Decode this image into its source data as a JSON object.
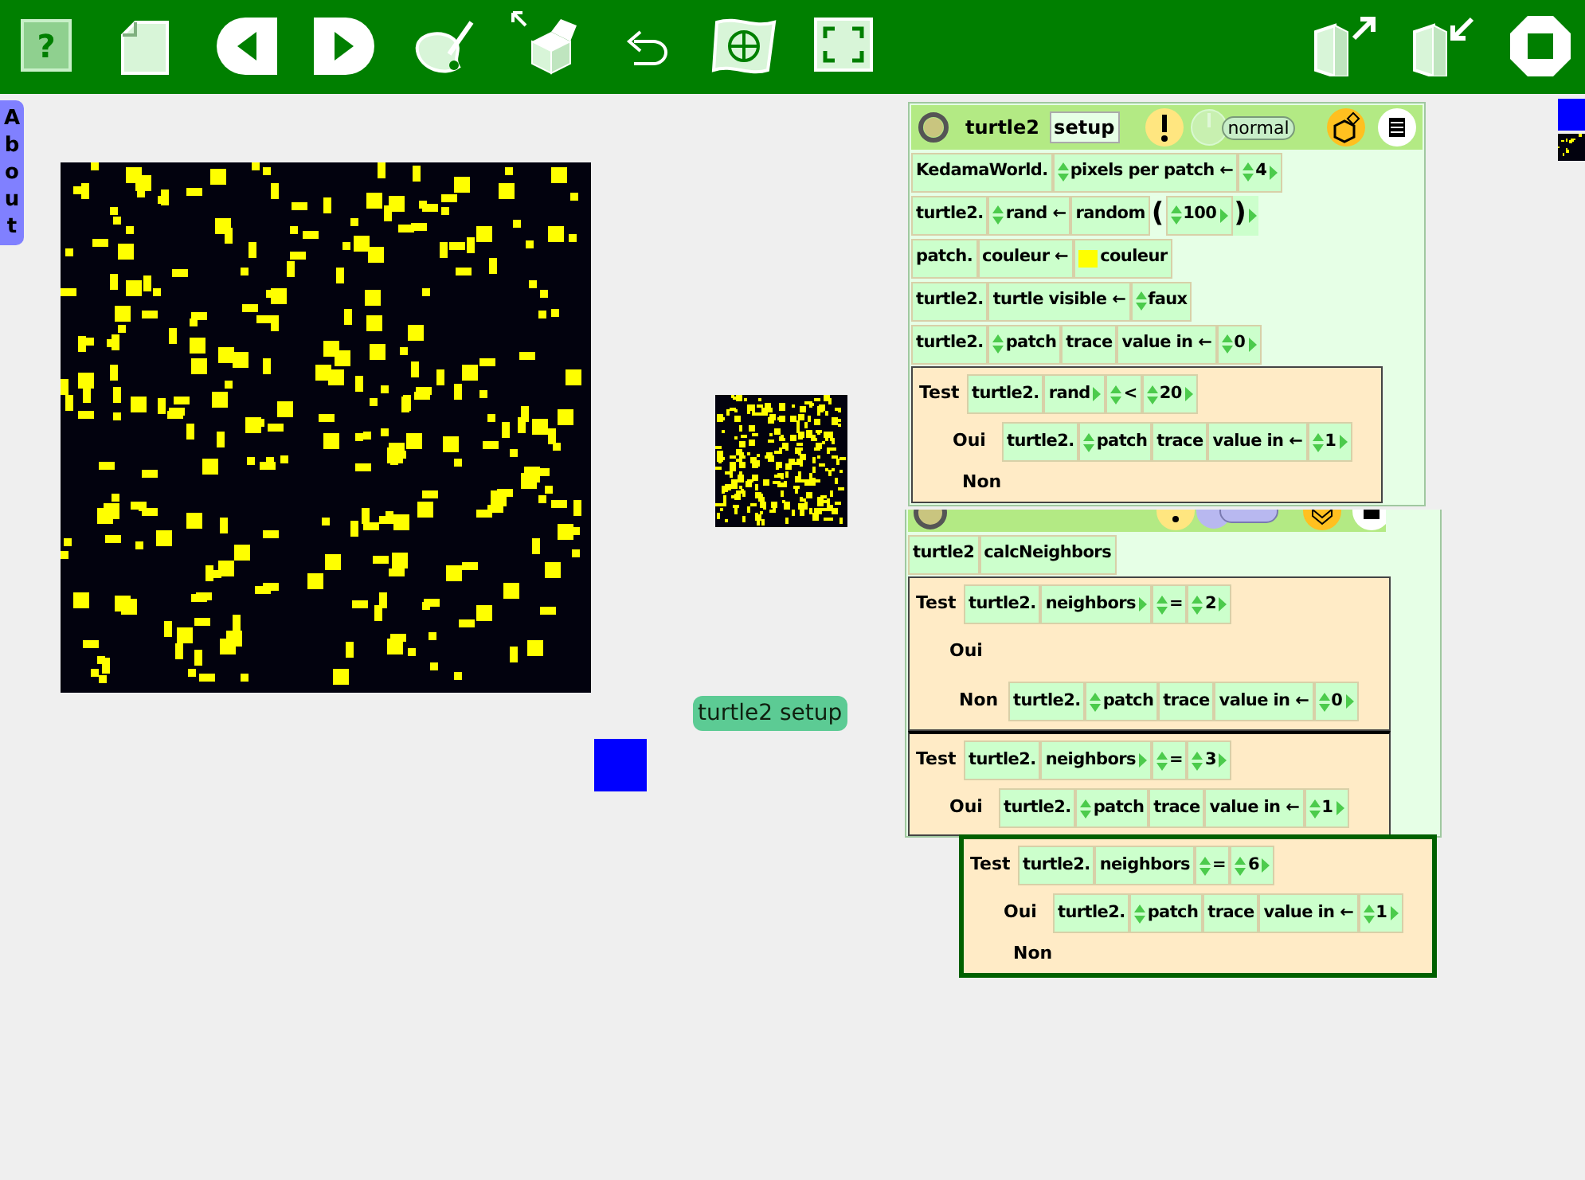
{
  "toolbar": {
    "help_label": "?"
  },
  "about_tab": {
    "label": "About"
  },
  "world": {
    "button": {
      "label": "turtle2 setup"
    }
  },
  "scripts": [
    {
      "kind": "editor",
      "player": "turtle2",
      "name": "setup",
      "tick_status": "normal",
      "lines": [
        {
          "kind": "row",
          "tiles": [
            {
              "kind": "tile",
              "text": "KedamaWorld.",
              "arrows": false,
              "more": false
            },
            {
              "kind": "tile",
              "text": "pixels per patch ←",
              "arrows": true,
              "more": false
            },
            {
              "kind": "tile",
              "text": "4",
              "arrows": true,
              "more": true
            }
          ]
        },
        {
          "kind": "row",
          "tiles": [
            {
              "kind": "tile",
              "text": "turtle2.",
              "arrows": false,
              "more": false
            },
            {
              "kind": "tile",
              "text": "rand ←",
              "arrows": true,
              "more": false
            },
            {
              "kind": "tile",
              "text": "random",
              "arrows": false,
              "more": false
            },
            {
              "kind": "paren",
              "text": "(",
              "more": false
            },
            {
              "kind": "tile",
              "text": "100",
              "arrows": true,
              "more": true
            },
            {
              "kind": "paren",
              "text": ")",
              "more": true
            }
          ]
        },
        {
          "kind": "row",
          "tiles": [
            {
              "kind": "tile",
              "text": "patch.",
              "arrows": false,
              "more": false
            },
            {
              "kind": "tile",
              "text": "couleur ←",
              "arrows": false,
              "more": false
            },
            {
              "kind": "tile",
              "text": "couleur",
              "arrows": false,
              "more": false,
              "color": "#ffff00"
            }
          ]
        },
        {
          "kind": "row",
          "tiles": [
            {
              "kind": "tile",
              "text": "turtle2.",
              "arrows": false,
              "more": false
            },
            {
              "kind": "tile",
              "text": "turtle visible ←",
              "arrows": false,
              "more": false
            },
            {
              "kind": "tile",
              "text": "faux",
              "arrows": true,
              "more": false
            }
          ]
        },
        {
          "kind": "row",
          "tiles": [
            {
              "kind": "tile",
              "text": "turtle2.",
              "arrows": false,
              "more": false
            },
            {
              "kind": "tile",
              "text": "patch",
              "arrows": true,
              "more": false
            },
            {
              "kind": "tile",
              "text": "trace",
              "arrows": false,
              "more": false
            },
            {
              "kind": "tile",
              "text": "value in ←",
              "arrows": false,
              "more": false
            },
            {
              "kind": "tile",
              "text": "0",
              "arrows": true,
              "more": true
            }
          ]
        },
        {
          "kind": "test",
          "highlighted": false,
          "label": "Test",
          "condition": [
            {
              "kind": "tile",
              "text": "turtle2.",
              "arrows": false,
              "more": false
            },
            {
              "kind": "tile",
              "text": "rand",
              "arrows": false,
              "more": true
            },
            {
              "kind": "tile",
              "text": "<",
              "arrows": true,
              "more": false
            },
            {
              "kind": "tile",
              "text": "20",
              "arrows": true,
              "more": true
            }
          ],
          "yes_label": "Oui",
          "yes": [
            {
              "kind": "tile",
              "text": "turtle2.",
              "arrows": false,
              "more": false
            },
            {
              "kind": "tile",
              "text": "patch",
              "arrows": true,
              "more": false
            },
            {
              "kind": "tile",
              "text": "trace",
              "arrows": false,
              "more": false
            },
            {
              "kind": "tile",
              "text": "value in ←",
              "arrows": false,
              "more": false
            },
            {
              "kind": "tile",
              "text": "1",
              "arrows": true,
              "more": true
            }
          ],
          "no_label": "Non"
        }
      ]
    },
    {
      "kind": "covered_editor",
      "lines": [
        {
          "kind": "row",
          "tiles": [
            {
              "kind": "tile",
              "text": "turtle2",
              "arrows": false,
              "more": false
            },
            {
              "kind": "tile",
              "text": "calcNeighbors",
              "arrows": false,
              "more": false
            }
          ]
        },
        {
          "kind": "test",
          "highlighted": false,
          "label": "Test",
          "condition": [
            {
              "kind": "tile",
              "text": "turtle2.",
              "arrows": false,
              "more": false
            },
            {
              "kind": "tile",
              "text": "neighbors",
              "arrows": false,
              "more": true
            },
            {
              "kind": "tile",
              "text": "=",
              "arrows": true,
              "more": false
            },
            {
              "kind": "tile",
              "text": "2",
              "arrows": true,
              "more": true
            }
          ],
          "yes_label": "Oui",
          "no_label": "Non",
          "no": [
            {
              "kind": "tile",
              "text": "turtle2.",
              "arrows": false,
              "more": false
            },
            {
              "kind": "tile",
              "text": "patch",
              "arrows": true,
              "more": false
            },
            {
              "kind": "tile",
              "text": "trace",
              "arrows": false,
              "more": false
            },
            {
              "kind": "tile",
              "text": "value in ←",
              "arrows": false,
              "more": false
            },
            {
              "kind": "tile",
              "text": "0",
              "arrows": true,
              "more": true
            }
          ]
        },
        {
          "kind": "test",
          "highlighted": false,
          "label": "Test",
          "condition": [
            {
              "kind": "tile",
              "text": "turtle2.",
              "arrows": false,
              "more": false
            },
            {
              "kind": "tile",
              "text": "neighbors",
              "arrows": false,
              "more": true
            },
            {
              "kind": "tile",
              "text": "=",
              "arrows": true,
              "more": false
            },
            {
              "kind": "tile",
              "text": "3",
              "arrows": true,
              "more": true
            }
          ],
          "yes_label": "Oui",
          "yes": [
            {
              "kind": "tile",
              "text": "turtle2.",
              "arrows": false,
              "more": false
            },
            {
              "kind": "tile",
              "text": "patch",
              "arrows": true,
              "more": false
            },
            {
              "kind": "tile",
              "text": "trace",
              "arrows": false,
              "more": false
            },
            {
              "kind": "tile",
              "text": "value in ←",
              "arrows": false,
              "more": false
            },
            {
              "kind": "tile",
              "text": "1",
              "arrows": true,
              "more": true
            }
          ]
        }
      ]
    },
    {
      "kind": "loose_block",
      "lines": [
        {
          "kind": "test",
          "highlighted": true,
          "label": "Test",
          "condition": [
            {
              "kind": "tile",
              "text": "turtle2.",
              "arrows": false,
              "more": false
            },
            {
              "kind": "tile",
              "text": "neighbors",
              "arrows": false,
              "more": false
            },
            {
              "kind": "tile",
              "text": "=",
              "arrows": true,
              "more": false
            },
            {
              "kind": "tile",
              "text": "6",
              "arrows": true,
              "more": true
            }
          ],
          "yes_label": "Oui",
          "yes": [
            {
              "kind": "tile",
              "text": "turtle2.",
              "arrows": false,
              "more": false
            },
            {
              "kind": "tile",
              "text": "patch",
              "arrows": true,
              "more": false
            },
            {
              "kind": "tile",
              "text": "trace",
              "arrows": false,
              "more": false
            },
            {
              "kind": "tile",
              "text": "value in ←",
              "arrows": false,
              "more": false
            },
            {
              "kind": "tile",
              "text": "1",
              "arrows": true,
              "more": true
            }
          ],
          "no_label": "Non"
        }
      ]
    }
  ]
}
